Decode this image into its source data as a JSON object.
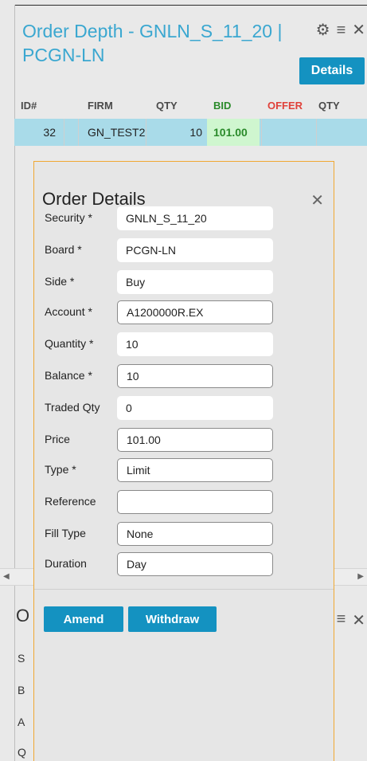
{
  "depth_panel": {
    "title": "Order Depth - GNLN_S_11_20 | PCGN-LN",
    "details_label": "Details",
    "columns": [
      "ID#",
      "FIRM",
      "QTY",
      "BID",
      "OFFER",
      "QTY"
    ],
    "rows": [
      {
        "id": "32",
        "firm": "GN_TEST2",
        "qty": "10",
        "bid": "101.00",
        "offer": "",
        "qty2": ""
      }
    ]
  },
  "background_panel": {
    "title_initial": "O",
    "row_initials": [
      "S",
      "B",
      "A",
      "Q"
    ]
  },
  "order_details": {
    "title": "Order Details",
    "fields": [
      {
        "label": "Security *",
        "value": "GNLN_S_11_20",
        "editable": false
      },
      {
        "label": "Board *",
        "value": "PCGN-LN",
        "editable": false
      },
      {
        "label": "Side *",
        "value": "Buy",
        "editable": false
      },
      {
        "label": "Account *",
        "value": "A1200000R.EX",
        "editable": true
      },
      {
        "label": "Quantity *",
        "value": "10",
        "editable": false
      },
      {
        "label": "Balance *",
        "value": "10",
        "editable": true
      },
      {
        "label": "Traded Qty",
        "value": "0",
        "editable": false
      },
      {
        "label": "Price",
        "value": "101.00",
        "editable": true
      },
      {
        "label": "Type *",
        "value": "Limit",
        "editable": true
      },
      {
        "label": "Reference",
        "value": "",
        "editable": true
      },
      {
        "label": "Fill Type",
        "value": "None",
        "editable": true
      },
      {
        "label": "Duration",
        "value": "Day",
        "editable": true
      }
    ],
    "amend_label": "Amend",
    "withdraw_label": "Withdraw"
  },
  "colors": {
    "accent": "#1492c1",
    "title_blue": "#3aa7d0",
    "bid_green": "#2a8a2a",
    "offer_red": "#e0413a",
    "dialog_border": "#f0a832",
    "row_highlight": "#a9dbe9"
  },
  "icons": [
    "gear-icon",
    "hamburger-menu-icon",
    "close-icon",
    "scroll-left-arrow-icon",
    "scroll-right-arrow-icon"
  ]
}
